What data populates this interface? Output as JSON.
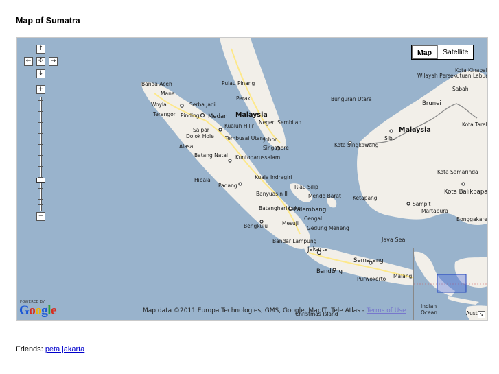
{
  "page": {
    "title": "Map of Sumatra"
  },
  "map": {
    "controls": {
      "pan_up": "↑",
      "pan_left": "←",
      "pan_center": "✣",
      "pan_right": "→",
      "pan_down": "↓",
      "zoom_in": "+",
      "zoom_out": "−"
    },
    "map_types": {
      "map_label": "Map",
      "satellite_label": "Satellite",
      "active": "Map"
    },
    "powered_by": "POWERED BY",
    "logo": {
      "letters": [
        "G",
        "o",
        "o",
        "g",
        "l",
        "e"
      ],
      "colors": [
        "#1a57d6",
        "#d62d20",
        "#f0b400",
        "#1a57d6",
        "#2e9d3a",
        "#d62d20"
      ]
    },
    "attribution": {
      "text": "Map data ©2011 Europa Technologies, GMS, Google, MapIT, Tele Atlas - ",
      "terms_link": "Terms of Use"
    },
    "labels": {
      "banda_aceh": "Banda Aceh",
      "mane": "Mane",
      "woyla": "Woyla",
      "serba_jadi": "Serba Jadi",
      "terangon": "Terangon",
      "pinding": "Pinding",
      "medan": "Medan",
      "saipar": "Saipar",
      "dolok_hole": "Dolok Hole",
      "alasa": "Alasa",
      "batang_natal": "Batang Natal",
      "hibala": "Hibala",
      "padang": "Padang",
      "pulau_pinang": "Pulau Pinang",
      "perak": "Perak",
      "malaysia_west": "Malaysia",
      "kualuh_hilir": "Kualuh Hilir",
      "negeri_sembilan": "Negeri Sembilan",
      "johor": "Johor",
      "tembusai_utara": "Tembusai Utara",
      "singapore": "Singapore",
      "kuntodarussalam": "Kuntodarussalam",
      "kuala_indragiri": "Kuala Indragiri",
      "banyuasin_ii": "Banyuasin II",
      "batanghari_leko": "Batanghari Leko",
      "riau_silip": "Riau Silip",
      "mendo_barat": "Mendo Barat",
      "palembang": "Palembang",
      "cengal": "Cengal",
      "bengkulu": "Bengkulu",
      "mesuji": "Mesuji",
      "gedung_meneng": "Gedung Meneng",
      "bandar_lampung": "Bandar Lampung",
      "jakarta": "Jakarta",
      "bandung": "Bandung",
      "semarang": "Semarang",
      "purwokerto": "Purwokerto",
      "malang": "Malang",
      "christmas_island": "Christmas Island",
      "bunguran_utara": "Bunguran Utara",
      "kota_singkawang": "Kota Singkawang",
      "sibu": "Sibu",
      "malaysia_east": "Malaysia",
      "wilayah_persekutuan_labuan": "Wilayah Persekutuan Labuan",
      "kota_kinabalu": "Kota Kinabalu",
      "sabah": "Sabah",
      "brunei": "Brunei",
      "kota_tarakan": "Kota Tarakan",
      "kota_samarinda": "Kota Samarinda",
      "kota_balikpapan": "Kota Balikpapan",
      "ketapang": "Ketapang",
      "sampit": "Sampit",
      "martapura": "Martapura",
      "bonggakaren": "Bonggakaren",
      "java_sea": "Java Sea"
    },
    "overview": {
      "indian_ocean": "Indian Ocean",
      "australia": "Austra",
      "toggle": "↘"
    },
    "colors": {
      "sea": "#99b3cc",
      "land": "#f2efe9",
      "road": "#fde88a",
      "border": "#8a8a8a"
    }
  },
  "footer": {
    "friends_label": "Friends:",
    "friends_link": "peta jakarta"
  }
}
